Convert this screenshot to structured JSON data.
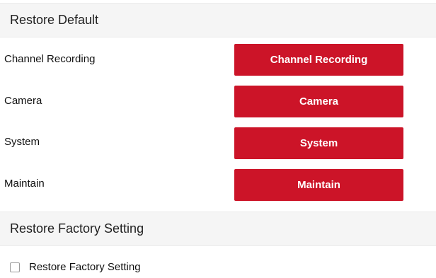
{
  "restore_default": {
    "title": "Restore Default",
    "rows": [
      {
        "label": "Channel Recording",
        "button": "Channel Recording"
      },
      {
        "label": "Camera",
        "button": "Camera"
      },
      {
        "label": "System",
        "button": "System"
      },
      {
        "label": "Maintain",
        "button": "Maintain"
      }
    ]
  },
  "restore_factory": {
    "title": "Restore Factory Setting",
    "checkbox_label": "Restore Factory Setting",
    "checkbox_checked": false
  },
  "colors": {
    "accent": "#cc1428",
    "header_bg": "#f5f5f5"
  }
}
